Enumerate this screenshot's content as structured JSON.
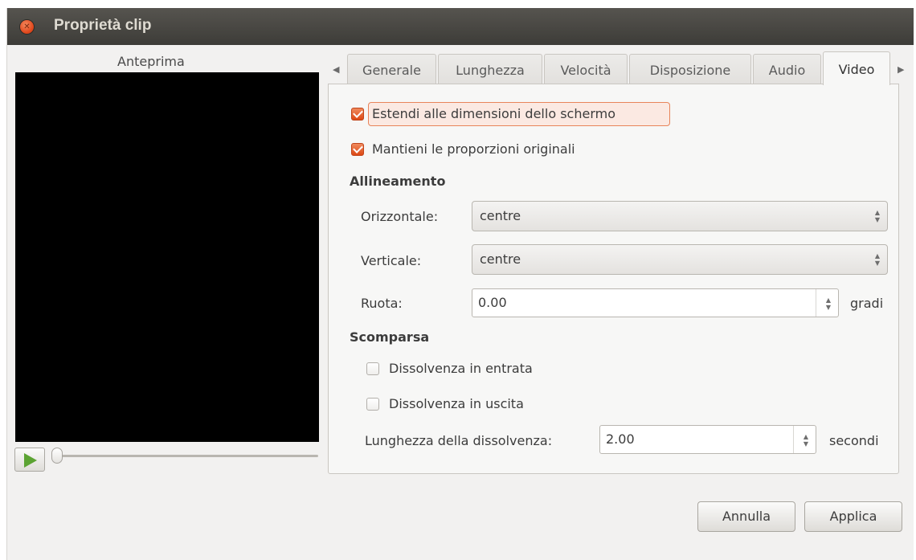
{
  "window": {
    "title": "Proprietà clip"
  },
  "preview": {
    "label": "Anteprima"
  },
  "tabs": [
    {
      "label": "Generale"
    },
    {
      "label": "Lunghezza"
    },
    {
      "label": "Velocità"
    },
    {
      "label": "Disposizione"
    },
    {
      "label": "Audio"
    },
    {
      "label": "Video",
      "active": true
    }
  ],
  "video": {
    "stretch_label": "Estendi alle dimensioni dello schermo",
    "stretch_checked": true,
    "keep_aspect_label": "Mantieni le proporzioni originali",
    "keep_aspect_checked": true,
    "alignment": {
      "title": "Allineamento",
      "horizontal_label": "Orizzontale:",
      "horizontal_value": "centre",
      "vertical_label": "Verticale:",
      "vertical_value": "centre",
      "rotate_label": "Ruota:",
      "rotate_value": "0.00",
      "rotate_unit": "gradi"
    },
    "fade": {
      "title": "Scomparsa",
      "fade_in_label": "Dissolvenza in entrata",
      "fade_in_checked": false,
      "fade_out_label": "Dissolvenza in uscita",
      "fade_out_checked": false,
      "length_label": "Lunghezza della dissolvenza:",
      "length_value": "2.00",
      "length_unit": "secondi"
    }
  },
  "buttons": {
    "cancel": "Annulla",
    "apply": "Applica"
  },
  "colors": {
    "accent": "#dd4814",
    "titlebar": "#3d3c38",
    "play": "#5ba332"
  }
}
